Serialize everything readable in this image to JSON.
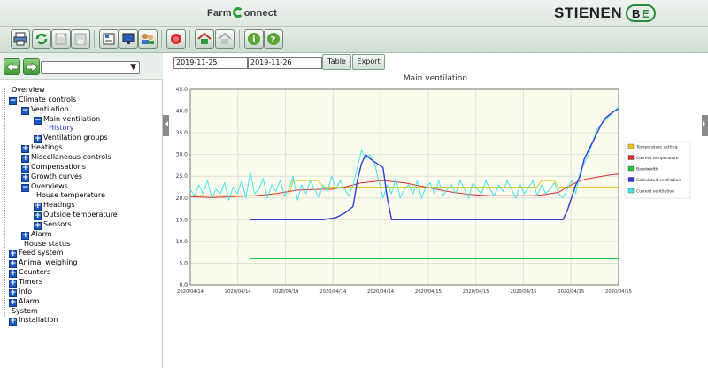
{
  "header": {
    "brand_left": "Farm",
    "brand_right": "onnect",
    "logo_text": "STIENEN"
  },
  "toolbar": {
    "icons": [
      "print-icon",
      "refresh-icon",
      "save-disabled-icon",
      "save-all-disabled-icon",
      "report-icon",
      "monitor-icon",
      "users-icon",
      "alarm-bell-icon",
      "home-icon",
      "home-disabled-icon",
      "info-icon",
      "help-icon"
    ]
  },
  "nav": {
    "back_icon": "arrow-left-icon",
    "forward_icon": "arrow-right-icon",
    "select_value": "",
    "tree": [
      {
        "label": "Overview",
        "level": 0,
        "icon": "none"
      },
      {
        "label": "Climate controls",
        "level": 0,
        "icon": "minus"
      },
      {
        "label": "Ventilation",
        "level": 1,
        "icon": "minus"
      },
      {
        "label": "Main ventilation",
        "level": 2,
        "icon": "minus"
      },
      {
        "label": "History",
        "level": 3,
        "icon": "none",
        "selected": true
      },
      {
        "label": "Ventilation groups",
        "level": 2,
        "icon": "plus"
      },
      {
        "label": "Heatings",
        "level": 1,
        "icon": "plus"
      },
      {
        "label": "Miscellaneous controls",
        "level": 1,
        "icon": "plus"
      },
      {
        "label": "Compensations",
        "level": 1,
        "icon": "plus"
      },
      {
        "label": "Growth curves",
        "level": 1,
        "icon": "plus"
      },
      {
        "label": "Overviews",
        "level": 1,
        "icon": "minus"
      },
      {
        "label": "House temperature",
        "level": 2,
        "icon": "none"
      },
      {
        "label": "Heatings",
        "level": 2,
        "icon": "plus"
      },
      {
        "label": "Outside temperature",
        "level": 2,
        "icon": "plus"
      },
      {
        "label": "Sensors",
        "level": 2,
        "icon": "plus"
      },
      {
        "label": "Alarm",
        "level": 1,
        "icon": "plus"
      },
      {
        "label": "House status",
        "level": 1,
        "icon": "none"
      },
      {
        "label": "Feed system",
        "level": 0,
        "icon": "plus"
      },
      {
        "label": "Animal weighing",
        "level": 0,
        "icon": "plus"
      },
      {
        "label": "Counters",
        "level": 0,
        "icon": "plus"
      },
      {
        "label": "Timers",
        "level": 0,
        "icon": "plus"
      },
      {
        "label": "Info",
        "level": 0,
        "icon": "plus"
      },
      {
        "label": "Alarm",
        "level": 0,
        "icon": "plus"
      },
      {
        "label": "System",
        "level": 0,
        "icon": "none"
      },
      {
        "label": "Installation",
        "level": 0,
        "icon": "plus"
      }
    ]
  },
  "filter": {
    "date_from": "2019-11-25",
    "date_to": "2019-11-26",
    "table_label": "Table",
    "export_label": "Export"
  },
  "colors": {
    "temperature_setting": "#f0c419",
    "current_temperature": "#dd2b2b",
    "bandwidth": "#22c43a",
    "calculated_ventilation": "#2a3fd6",
    "current_ventilation": "#46e3e8",
    "plot_bg": "#fbfbee"
  },
  "chart_data": {
    "type": "line",
    "title": "Main ventilation",
    "ylim": [
      0,
      45
    ],
    "yticks": [
      "0.0",
      "5.0",
      "10.0",
      "15.0",
      "20.0",
      "25.0",
      "30.0",
      "35.0",
      "40.0",
      "45.0"
    ],
    "xticks": [
      "2020/04/14",
      "2020/04/14",
      "2020/04/14",
      "2020/04/14",
      "2020/04/14",
      "2020/04/15",
      "2020/04/15",
      "2020/04/15",
      "2020/04/15",
      "2020/04/15"
    ],
    "grid": true,
    "legend_position": "right",
    "x_range": [
      0,
      100
    ],
    "series": [
      {
        "name": "Temperature setting",
        "color_key": "temperature_setting",
        "x": [
          0,
          14,
          23,
          24,
          28,
          30,
          31,
          36,
          39,
          40,
          45,
          52,
          58,
          68,
          77,
          81,
          82,
          85,
          86,
          100
        ],
        "y": [
          20.5,
          20.5,
          20.5,
          24,
          24,
          24,
          22.5,
          22.5,
          22.5,
          22.5,
          22.5,
          22.5,
          22.5,
          22.5,
          22.5,
          22.5,
          24,
          24,
          22.5,
          22.5
        ]
      },
      {
        "name": "Current temperature",
        "color_key": "current_temperature",
        "x": [
          0,
          5,
          10,
          15,
          20,
          25,
          30,
          33,
          36,
          40,
          45,
          50,
          55,
          60,
          65,
          70,
          75,
          80,
          83,
          86,
          88,
          90,
          92,
          95,
          98,
          100
        ],
        "y": [
          20.3,
          20.1,
          20.3,
          20.5,
          21,
          21.8,
          22,
          22,
          22.5,
          23.5,
          24,
          23.5,
          22.5,
          21.5,
          20.8,
          20.5,
          20.5,
          20.5,
          20.8,
          21.3,
          22.5,
          23.5,
          24.3,
          24.8,
          25.3,
          25.5
        ]
      },
      {
        "name": "Bandwidth",
        "color_key": "bandwidth",
        "x": [
          14,
          100
        ],
        "y": [
          6,
          6
        ]
      },
      {
        "name": "Calculated ventilation",
        "color_key": "calculated_ventilation",
        "x": [
          14,
          28,
          29,
          31,
          32,
          34,
          36,
          38,
          39,
          40,
          41,
          42,
          45,
          46,
          47,
          50,
          55,
          60,
          65,
          70,
          75,
          80,
          83,
          86,
          87,
          88,
          90,
          91,
          92,
          94,
          95,
          96,
          97,
          99,
          100
        ],
        "y": [
          15,
          15,
          15,
          15,
          15.2,
          15.5,
          16.5,
          18,
          24,
          28,
          30,
          29,
          27,
          20,
          15,
          15,
          15,
          15,
          15,
          15,
          15,
          15,
          15,
          15,
          15,
          17,
          23,
          25,
          29,
          33,
          35,
          37,
          38.5,
          40,
          40.5
        ]
      },
      {
        "name": "Current ventilation",
        "color_key": "current_ventilation",
        "x": [
          0,
          1,
          2,
          3,
          4,
          5,
          6,
          7,
          8,
          9,
          10,
          11,
          12,
          13,
          14,
          15,
          16,
          17,
          18,
          19,
          20,
          21,
          22,
          23,
          24,
          25,
          26,
          27,
          28,
          29,
          30,
          31,
          32,
          33,
          34,
          35,
          36,
          37,
          38,
          39,
          40,
          41,
          42,
          43,
          44,
          45,
          46,
          47,
          48,
          49,
          50,
          51,
          52,
          53,
          54,
          55,
          56,
          57,
          58,
          59,
          60,
          61,
          62,
          63,
          64,
          65,
          66,
          67,
          68,
          69,
          70,
          71,
          72,
          73,
          74,
          75,
          76,
          77,
          78,
          79,
          80,
          81,
          82,
          83,
          84,
          85,
          86,
          87,
          88,
          89,
          90,
          91,
          92,
          93,
          94,
          95,
          96,
          97,
          98,
          99,
          100
        ],
        "y": [
          22,
          20.5,
          23,
          21,
          24,
          20,
          22,
          21,
          23.5,
          19.5,
          22.5,
          21,
          24,
          20,
          26,
          21,
          22,
          24.5,
          20,
          23,
          21.5,
          24,
          20.5,
          22,
          25,
          19.5,
          23,
          21,
          24,
          22,
          20,
          23,
          21.5,
          25,
          22,
          24,
          22,
          20.5,
          23,
          27,
          31,
          29,
          30,
          28,
          24,
          20,
          23,
          21,
          24.5,
          20,
          22,
          23,
          21,
          24,
          20,
          22.5,
          23.5,
          21,
          24,
          20.5,
          22,
          23,
          21,
          24,
          22,
          20,
          23.5,
          22,
          21,
          24,
          22,
          20.5,
          23,
          21.5,
          24,
          22,
          20,
          23,
          21,
          22.5,
          24,
          20.5,
          23,
          21,
          22,
          23.5,
          21,
          20,
          22,
          24,
          21,
          26,
          28,
          30,
          33,
          36,
          37,
          38,
          39,
          40,
          41
        ]
      }
    ]
  },
  "legend": [
    {
      "label": "Temperature setting",
      "color_key": "temperature_setting"
    },
    {
      "label": "Current temperature",
      "color_key": "current_temperature"
    },
    {
      "label": "Bandwidth",
      "color_key": "bandwidth"
    },
    {
      "label": "Calculated ventilation",
      "color_key": "calculated_ventilation"
    },
    {
      "label": "Current ventilation",
      "color_key": "current_ventilation"
    }
  ]
}
